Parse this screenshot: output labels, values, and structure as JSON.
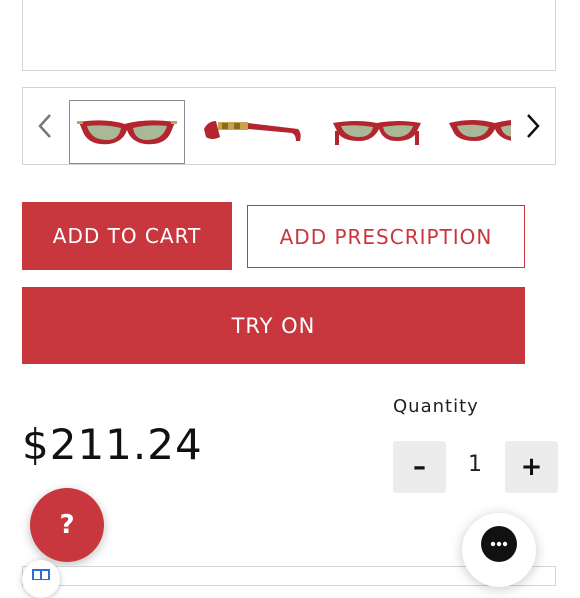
{
  "gallery": {
    "prev_icon": "chevron-left-icon",
    "next_icon": "chevron-right-icon",
    "thumbnails": [
      {
        "view": "front",
        "selected": true
      },
      {
        "view": "side",
        "selected": false
      },
      {
        "view": "front",
        "selected": false
      },
      {
        "view": "angle",
        "selected": false
      }
    ]
  },
  "actions": {
    "add_to_cart": "ADD TO CART",
    "add_prescription": "ADD PRESCRIPTION",
    "try_on": "TRY ON"
  },
  "product": {
    "price": "$211.24"
  },
  "quantity": {
    "label": "Quantity",
    "value": "1",
    "minus": "–",
    "plus": "+"
  },
  "help": {
    "label": "?"
  },
  "colors": {
    "accent": "#c8373d",
    "frame": "#b3262f",
    "lens": "#a9b896"
  }
}
